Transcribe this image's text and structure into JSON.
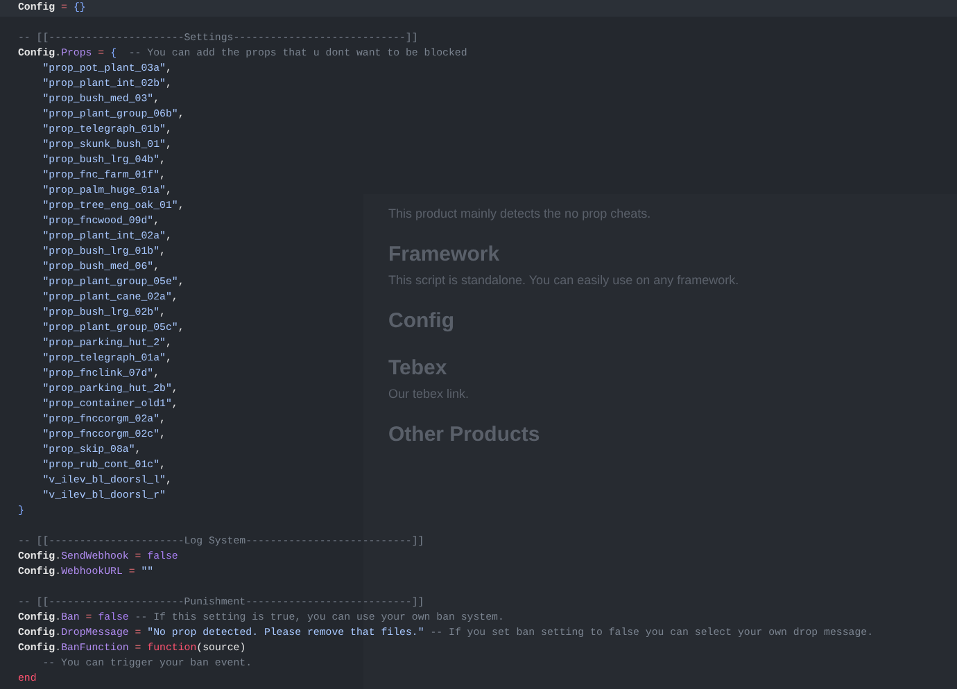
{
  "code_blocks": [
    {
      "lines": [
        {
          "segments": [
            {
              "kind": "identifier",
              "t": "Config"
            },
            {
              "kind": "operator",
              "t": " = "
            },
            {
              "kind": "brace",
              "t": "{}"
            }
          ]
        }
      ]
    },
    {
      "lines": [
        {
          "segments": [
            {
              "kind": "comment",
              "t": "-- [[----------------------Settings----------------------------]]"
            }
          ]
        },
        {
          "segments": [
            {
              "kind": "identifier",
              "t": "Config"
            },
            {
              "kind": "dot",
              "t": "."
            },
            {
              "kind": "property",
              "t": "Props"
            },
            {
              "kind": "operator",
              "t": " = "
            },
            {
              "kind": "brace",
              "t": "{"
            },
            {
              "kind": "comment",
              "t": "  -- You can add the props that u dont want to be blocked"
            }
          ]
        },
        {
          "segments": [
            {
              "kind": "string",
              "t": "    \"prop_pot_plant_03a\""
            },
            {
              "kind": "plain",
              "t": ","
            }
          ]
        },
        {
          "segments": [
            {
              "kind": "string",
              "t": "    \"prop_plant_int_02b\""
            },
            {
              "kind": "plain",
              "t": ","
            }
          ]
        },
        {
          "segments": [
            {
              "kind": "string",
              "t": "    \"prop_bush_med_03\""
            },
            {
              "kind": "plain",
              "t": ","
            }
          ]
        },
        {
          "segments": [
            {
              "kind": "string",
              "t": "    \"prop_plant_group_06b\""
            },
            {
              "kind": "plain",
              "t": ","
            }
          ]
        },
        {
          "segments": [
            {
              "kind": "string",
              "t": "    \"prop_telegraph_01b\""
            },
            {
              "kind": "plain",
              "t": ","
            }
          ]
        },
        {
          "segments": [
            {
              "kind": "string",
              "t": "    \"prop_skunk_bush_01\""
            },
            {
              "kind": "plain",
              "t": ","
            }
          ]
        },
        {
          "segments": [
            {
              "kind": "string",
              "t": "    \"prop_bush_lrg_04b\""
            },
            {
              "kind": "plain",
              "t": ","
            }
          ]
        },
        {
          "segments": [
            {
              "kind": "string",
              "t": "    \"prop_fnc_farm_01f\""
            },
            {
              "kind": "plain",
              "t": ","
            }
          ]
        },
        {
          "segments": [
            {
              "kind": "string",
              "t": "    \"prop_palm_huge_01a\""
            },
            {
              "kind": "plain",
              "t": ","
            }
          ]
        },
        {
          "segments": [
            {
              "kind": "string",
              "t": "    \"prop_tree_eng_oak_01\""
            },
            {
              "kind": "plain",
              "t": ","
            }
          ]
        },
        {
          "segments": [
            {
              "kind": "string",
              "t": "    \"prop_fncwood_09d\""
            },
            {
              "kind": "plain",
              "t": ","
            }
          ]
        },
        {
          "segments": [
            {
              "kind": "string",
              "t": "    \"prop_plant_int_02a\""
            },
            {
              "kind": "plain",
              "t": ","
            }
          ]
        },
        {
          "segments": [
            {
              "kind": "string",
              "t": "    \"prop_bush_lrg_01b\""
            },
            {
              "kind": "plain",
              "t": ","
            }
          ]
        },
        {
          "segments": [
            {
              "kind": "string",
              "t": "    \"prop_bush_med_06\""
            },
            {
              "kind": "plain",
              "t": ","
            }
          ]
        },
        {
          "segments": [
            {
              "kind": "string",
              "t": "    \"prop_plant_group_05e\""
            },
            {
              "kind": "plain",
              "t": ","
            }
          ]
        },
        {
          "segments": [
            {
              "kind": "string",
              "t": "    \"prop_plant_cane_02a\""
            },
            {
              "kind": "plain",
              "t": ","
            }
          ]
        },
        {
          "segments": [
            {
              "kind": "string",
              "t": "    \"prop_bush_lrg_02b\""
            },
            {
              "kind": "plain",
              "t": ","
            }
          ]
        },
        {
          "segments": [
            {
              "kind": "string",
              "t": "    \"prop_plant_group_05c\""
            },
            {
              "kind": "plain",
              "t": ","
            }
          ]
        },
        {
          "segments": [
            {
              "kind": "string",
              "t": "    \"prop_parking_hut_2\""
            },
            {
              "kind": "plain",
              "t": ","
            }
          ]
        },
        {
          "segments": [
            {
              "kind": "string",
              "t": "    \"prop_telegraph_01a\""
            },
            {
              "kind": "plain",
              "t": ","
            }
          ]
        },
        {
          "segments": [
            {
              "kind": "string",
              "t": "    \"prop_fnclink_07d\""
            },
            {
              "kind": "plain",
              "t": ","
            }
          ]
        },
        {
          "segments": [
            {
              "kind": "string",
              "t": "    \"prop_parking_hut_2b\""
            },
            {
              "kind": "plain",
              "t": ","
            }
          ]
        },
        {
          "segments": [
            {
              "kind": "string",
              "t": "    \"prop_container_old1\""
            },
            {
              "kind": "plain",
              "t": ","
            }
          ]
        },
        {
          "segments": [
            {
              "kind": "string",
              "t": "    \"prop_fnccorgm_02a\""
            },
            {
              "kind": "plain",
              "t": ","
            }
          ]
        },
        {
          "segments": [
            {
              "kind": "string",
              "t": "    \"prop_fnccorgm_02c\""
            },
            {
              "kind": "plain",
              "t": ","
            }
          ]
        },
        {
          "segments": [
            {
              "kind": "string",
              "t": "    \"prop_skip_08a\""
            },
            {
              "kind": "plain",
              "t": ","
            }
          ]
        },
        {
          "segments": [
            {
              "kind": "string",
              "t": "    \"prop_rub_cont_01c\""
            },
            {
              "kind": "plain",
              "t": ","
            }
          ]
        },
        {
          "segments": [
            {
              "kind": "string",
              "t": "    \"v_ilev_bl_doorsl_l\""
            },
            {
              "kind": "plain",
              "t": ","
            }
          ]
        },
        {
          "segments": [
            {
              "kind": "string",
              "t": "    \"v_ilev_bl_doorsl_r\""
            }
          ]
        },
        {
          "segments": [
            {
              "kind": "brace",
              "t": "}"
            }
          ]
        }
      ]
    },
    {
      "lines": [
        {
          "segments": [
            {
              "kind": "comment",
              "t": "-- [[----------------------Log System---------------------------]]"
            }
          ]
        },
        {
          "segments": [
            {
              "kind": "identifier",
              "t": "Config"
            },
            {
              "kind": "dot",
              "t": "."
            },
            {
              "kind": "property",
              "t": "SendWebhook"
            },
            {
              "kind": "operator",
              "t": " = "
            },
            {
              "kind": "boolean",
              "t": "false"
            }
          ]
        },
        {
          "segments": [
            {
              "kind": "identifier",
              "t": "Config"
            },
            {
              "kind": "dot",
              "t": "."
            },
            {
              "kind": "property",
              "t": "WebhookURL"
            },
            {
              "kind": "operator",
              "t": " = "
            },
            {
              "kind": "string",
              "t": "\"\""
            }
          ]
        }
      ]
    },
    {
      "lines": [
        {
          "segments": [
            {
              "kind": "comment",
              "t": "-- [[----------------------Punishment---------------------------]]"
            }
          ]
        },
        {
          "segments": [
            {
              "kind": "identifier",
              "t": "Config"
            },
            {
              "kind": "dot",
              "t": "."
            },
            {
              "kind": "property",
              "t": "Ban"
            },
            {
              "kind": "operator",
              "t": " = "
            },
            {
              "kind": "boolean",
              "t": "false"
            },
            {
              "kind": "comment",
              "t": " -- If this setting is true, you can use your own ban system."
            }
          ]
        },
        {
          "segments": [
            {
              "kind": "identifier",
              "t": "Config"
            },
            {
              "kind": "dot",
              "t": "."
            },
            {
              "kind": "property",
              "t": "DropMessage"
            },
            {
              "kind": "operator",
              "t": " = "
            },
            {
              "kind": "string",
              "t": "\"No prop detected. Please remove that files.\""
            },
            {
              "kind": "comment",
              "t": " -- If you set ban setting to false you can select your own drop message."
            }
          ]
        },
        {
          "segments": [
            {
              "kind": "identifier",
              "t": "Config"
            },
            {
              "kind": "dot",
              "t": "."
            },
            {
              "kind": "property",
              "t": "BanFunction"
            },
            {
              "kind": "operator",
              "t": " = "
            },
            {
              "kind": "keyword",
              "t": "function"
            },
            {
              "kind": "plain",
              "t": "(source)"
            }
          ]
        },
        {
          "segments": [
            {
              "kind": "comment",
              "t": "    -- You can trigger your ban event."
            }
          ]
        },
        {
          "segments": [
            {
              "kind": "keyword",
              "t": "end"
            }
          ]
        }
      ]
    }
  ],
  "background_page": [
    {
      "kind": "text",
      "text": "This product mainly detects the no prop cheats."
    },
    {
      "kind": "heading",
      "text": "Framework"
    },
    {
      "kind": "text",
      "text": "This script is standalone. You can easily use on any framework."
    },
    {
      "kind": "heading",
      "text": "Config"
    },
    {
      "kind": "heading",
      "text": "Tebex"
    },
    {
      "kind": "text",
      "text": "Our tebex link."
    },
    {
      "kind": "heading",
      "text": "Other Products"
    }
  ]
}
